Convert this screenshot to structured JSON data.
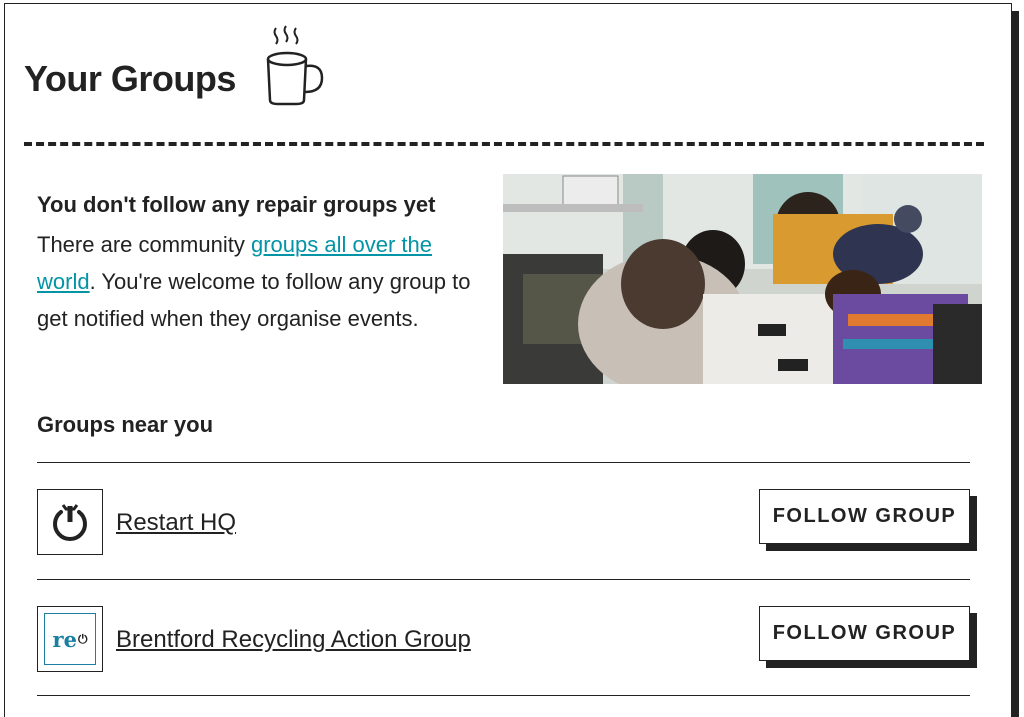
{
  "header": {
    "title": "Your Groups",
    "icon": "coffee-mug-icon"
  },
  "empty_state": {
    "title": "You don't follow any repair groups yet",
    "text_before": "There are community ",
    "link_text": "groups all over the world",
    "text_after": ". You're welcome to follow any group to get notified when they organise events.",
    "image": "people-repairing-devices-photo"
  },
  "near": {
    "title": "Groups near you"
  },
  "groups": [
    {
      "name": "Restart HQ",
      "logo": "restart-power-wrench-icon",
      "button": "FOLLOW GROUP"
    },
    {
      "name": "Brentford Recycling Action Group",
      "logo_text": "re",
      "logo": "re-power-logo",
      "button": "FOLLOW GROUP"
    }
  ],
  "colors": {
    "text": "#222222",
    "link": "#0394a6",
    "border": "#222222"
  }
}
